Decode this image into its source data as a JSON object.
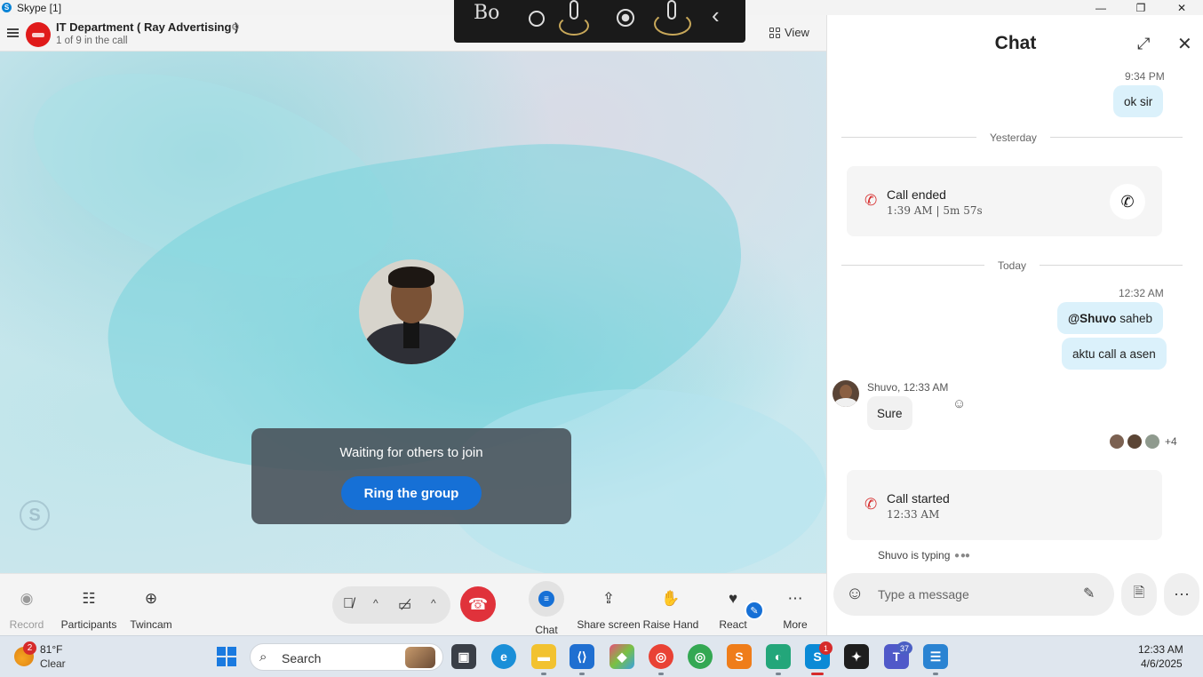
{
  "window": {
    "title": "Skype [1]",
    "minimize": "—",
    "maximize": "❐",
    "close": "✕"
  },
  "call_header": {
    "group_name": "IT Department ( Ray Advertising )",
    "participants_text": "1 of 9 in the call",
    "view_label": "View"
  },
  "stage": {
    "waiting_text": "Waiting for others to join",
    "ring_button": "Ring the group"
  },
  "controls": {
    "record": "Record",
    "participants": "Participants",
    "twincam": "Twincam",
    "chat": "Chat",
    "share_screen": "Share screen",
    "raise_hand": "Raise Hand",
    "react": "React",
    "more": "More"
  },
  "chat": {
    "title": "Chat",
    "messages": [
      {
        "time": "9:34 PM",
        "text": "ok sir"
      }
    ],
    "divider_yesterday": "Yesterday",
    "call_ended": {
      "title": "Call ended",
      "detail": "1:39 AM | 5m 57s"
    },
    "divider_today": "Today",
    "today_time": "12:32 AM",
    "mention": "@Shuvo",
    "mention_rest": "saheb",
    "msg2": "aktu call a asen",
    "reply_sender": "Shuvo, 12:33 AM",
    "reply_text": "Sure",
    "seen_more": "+4",
    "call_started": {
      "title": "Call started",
      "detail": "12:33 AM"
    },
    "typing": "Shuvo is typing",
    "composer_placeholder": "Type a message"
  },
  "taskbar": {
    "weather_badge": "2",
    "temperature": "81°F",
    "condition": "Clear",
    "search_label": "Search",
    "skype_badge": "1",
    "teams_badge": "37",
    "time": "12:33 AM",
    "date": "4/6/2025"
  },
  "icons": {
    "skype_logo": "S",
    "settings": "⚙",
    "expand": "⤢",
    "close": "✕",
    "phone": "✆",
    "emoji": "☺",
    "more": "⋯"
  },
  "colors": {
    "brand": "#1670d6",
    "hangup": "#e0323b",
    "outgoing_bubble": "#dbf1fb",
    "incoming_bubble": "#f1f1f1"
  }
}
